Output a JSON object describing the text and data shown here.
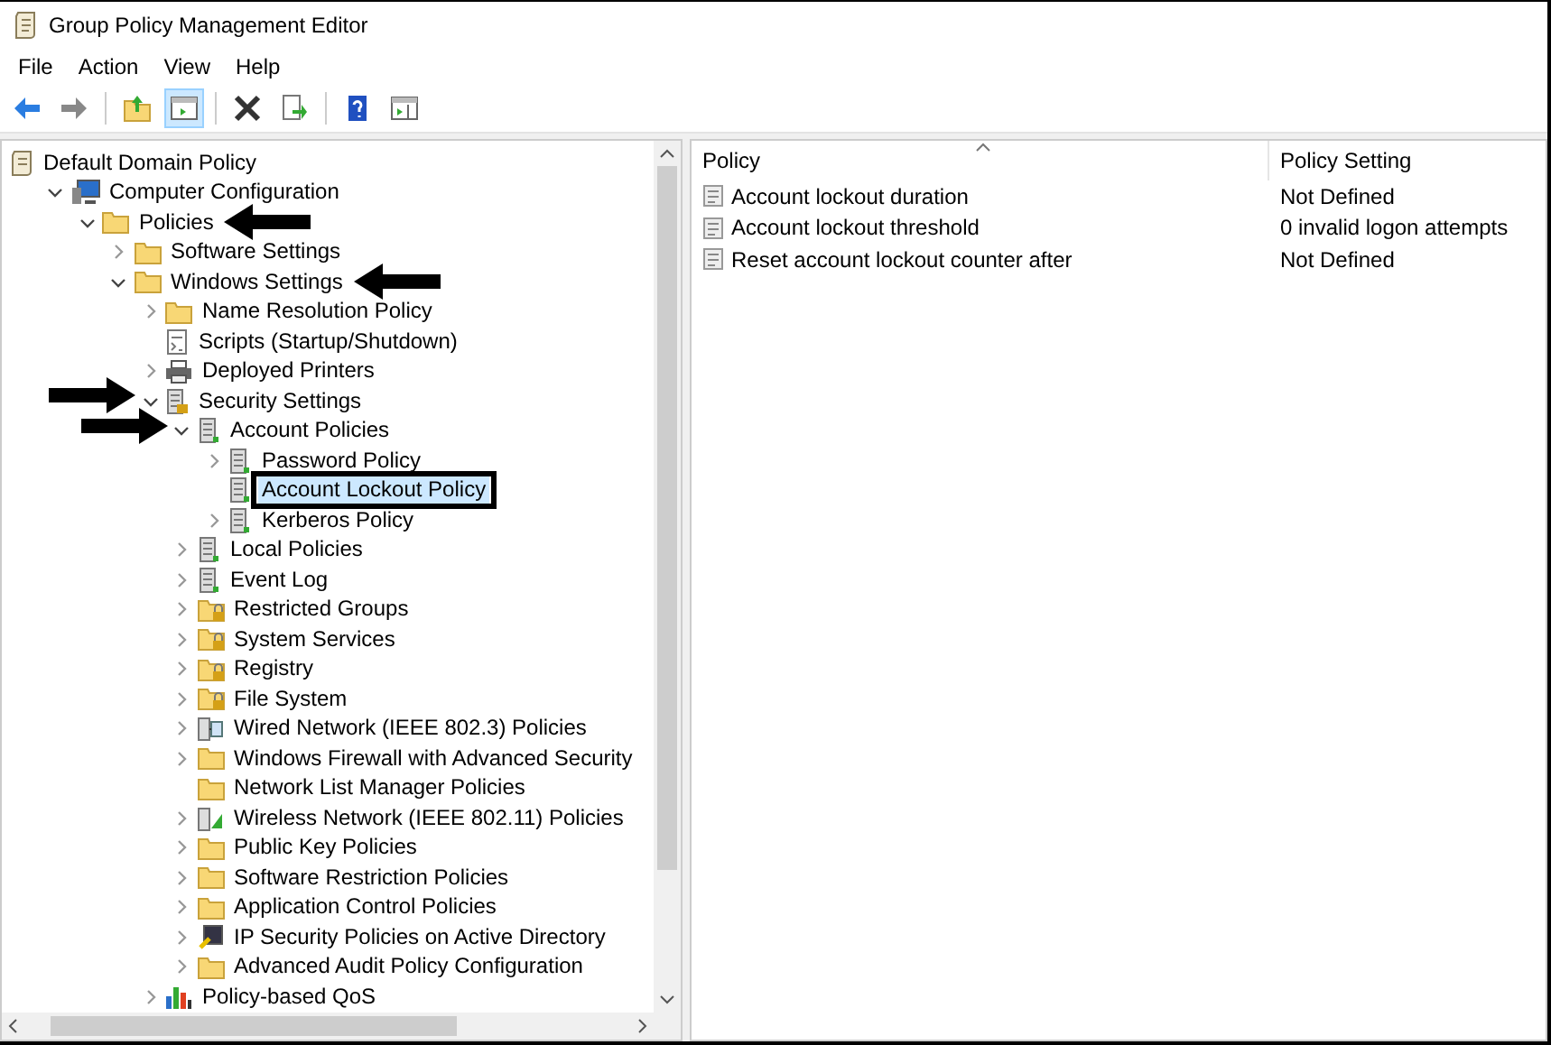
{
  "window": {
    "title": "Group Policy Management Editor"
  },
  "menu": [
    "File",
    "Action",
    "View",
    "Help"
  ],
  "tree": [
    {
      "label": "Default Domain Policy",
      "kind": "scroll",
      "selected": false,
      "outlined": false,
      "arrow_before": false,
      "arrow_after": false,
      "children": [
        {
          "label": "Computer Configuration",
          "kind": "computer",
          "leaf": false,
          "expanded": true,
          "selected": false,
          "outlined": false,
          "arrow_before": false,
          "arrow_after": false,
          "children": [
            {
              "label": "Policies",
              "kind": "folder",
              "leaf": false,
              "expanded": true,
              "selected": false,
              "outlined": false,
              "arrow_before": false,
              "arrow_after": true,
              "children": [
                {
                  "label": "Software Settings",
                  "kind": "folder",
                  "leaf": false,
                  "expanded": false,
                  "selected": false,
                  "outlined": false,
                  "arrow_before": false,
                  "arrow_after": false
                },
                {
                  "label": "Windows Settings",
                  "kind": "folder",
                  "leaf": false,
                  "expanded": true,
                  "selected": false,
                  "outlined": false,
                  "arrow_before": false,
                  "arrow_after": true,
                  "children": [
                    {
                      "label": "Name Resolution Policy",
                      "kind": "folder",
                      "leaf": false,
                      "expanded": false,
                      "selected": false,
                      "outlined": false,
                      "arrow_before": false,
                      "arrow_after": false
                    },
                    {
                      "label": "Scripts (Startup/Shutdown)",
                      "kind": "script",
                      "leaf": true,
                      "selected": false,
                      "outlined": false,
                      "arrow_before": false,
                      "arrow_after": false
                    },
                    {
                      "label": "Deployed Printers",
                      "kind": "printer",
                      "leaf": false,
                      "expanded": false,
                      "selected": false,
                      "outlined": false,
                      "arrow_before": false,
                      "arrow_after": false
                    },
                    {
                      "label": "Security Settings",
                      "kind": "security",
                      "leaf": false,
                      "expanded": true,
                      "selected": false,
                      "outlined": false,
                      "arrow_before": true,
                      "arrow_after": false,
                      "children": [
                        {
                          "label": "Account Policies",
                          "kind": "policy",
                          "leaf": false,
                          "expanded": true,
                          "selected": false,
                          "outlined": false,
                          "arrow_before": true,
                          "arrow_after": false,
                          "children": [
                            {
                              "label": "Password Policy",
                              "kind": "policy",
                              "leaf": false,
                              "expanded": false,
                              "selected": false,
                              "outlined": false,
                              "arrow_before": false,
                              "arrow_after": false
                            },
                            {
                              "label": "Account Lockout Policy",
                              "kind": "policy",
                              "leaf": true,
                              "selected": true,
                              "outlined": true,
                              "arrow_before": false,
                              "arrow_after": false
                            },
                            {
                              "label": "Kerberos Policy",
                              "kind": "policy",
                              "leaf": false,
                              "expanded": false,
                              "selected": false,
                              "outlined": false,
                              "arrow_before": false,
                              "arrow_after": false
                            }
                          ]
                        },
                        {
                          "label": "Local Policies",
                          "kind": "policy",
                          "leaf": false,
                          "expanded": false,
                          "selected": false,
                          "outlined": false,
                          "arrow_before": false,
                          "arrow_after": false
                        },
                        {
                          "label": "Event Log",
                          "kind": "policy",
                          "leaf": false,
                          "expanded": false,
                          "selected": false,
                          "outlined": false,
                          "arrow_before": false,
                          "arrow_after": false
                        },
                        {
                          "label": "Restricted Groups",
                          "kind": "lockfolder",
                          "leaf": false,
                          "expanded": false,
                          "selected": false,
                          "outlined": false,
                          "arrow_before": false,
                          "arrow_after": false
                        },
                        {
                          "label": "System Services",
                          "kind": "lockfolder",
                          "leaf": false,
                          "expanded": false,
                          "selected": false,
                          "outlined": false,
                          "arrow_before": false,
                          "arrow_after": false
                        },
                        {
                          "label": "Registry",
                          "kind": "lockfolder",
                          "leaf": false,
                          "expanded": false,
                          "selected": false,
                          "outlined": false,
                          "arrow_before": false,
                          "arrow_after": false
                        },
                        {
                          "label": "File System",
                          "kind": "lockfolder",
                          "leaf": false,
                          "expanded": false,
                          "selected": false,
                          "outlined": false,
                          "arrow_before": false,
                          "arrow_after": false
                        },
                        {
                          "label": "Wired Network (IEEE 802.3) Policies",
                          "kind": "network",
                          "leaf": false,
                          "expanded": false,
                          "selected": false,
                          "outlined": false,
                          "arrow_before": false,
                          "arrow_after": false
                        },
                        {
                          "label": "Windows Firewall with Advanced Security",
                          "kind": "folder",
                          "leaf": false,
                          "expanded": false,
                          "selected": false,
                          "outlined": false,
                          "arrow_before": false,
                          "arrow_after": false
                        },
                        {
                          "label": "Network List Manager Policies",
                          "kind": "folder",
                          "leaf": true,
                          "selected": false,
                          "outlined": false,
                          "arrow_before": false,
                          "arrow_after": false
                        },
                        {
                          "label": "Wireless Network (IEEE 802.11) Policies",
                          "kind": "wireless",
                          "leaf": false,
                          "expanded": false,
                          "selected": false,
                          "outlined": false,
                          "arrow_before": false,
                          "arrow_after": false
                        },
                        {
                          "label": "Public Key Policies",
                          "kind": "folder",
                          "leaf": false,
                          "expanded": false,
                          "selected": false,
                          "outlined": false,
                          "arrow_before": false,
                          "arrow_after": false
                        },
                        {
                          "label": "Software Restriction Policies",
                          "kind": "folder",
                          "leaf": false,
                          "expanded": false,
                          "selected": false,
                          "outlined": false,
                          "arrow_before": false,
                          "arrow_after": false
                        },
                        {
                          "label": "Application Control Policies",
                          "kind": "folder",
                          "leaf": false,
                          "expanded": false,
                          "selected": false,
                          "outlined": false,
                          "arrow_before": false,
                          "arrow_after": false
                        },
                        {
                          "label": "IP Security Policies on Active Directory",
                          "kind": "ipsec",
                          "leaf": false,
                          "expanded": false,
                          "selected": false,
                          "outlined": false,
                          "arrow_before": false,
                          "arrow_after": false
                        },
                        {
                          "label": "Advanced Audit Policy Configuration",
                          "kind": "folder",
                          "leaf": false,
                          "expanded": false,
                          "selected": false,
                          "outlined": false,
                          "arrow_before": false,
                          "arrow_after": false
                        }
                      ]
                    },
                    {
                      "label": "Policy-based QoS",
                      "kind": "qos",
                      "leaf": false,
                      "expanded": false,
                      "selected": false,
                      "outlined": false,
                      "arrow_before": false,
                      "arrow_after": false
                    }
                  ]
                }
              ]
            }
          ]
        }
      ]
    }
  ],
  "table": {
    "columns": [
      "Policy",
      "Policy Setting"
    ],
    "rows": [
      {
        "policy": "Account lockout duration",
        "setting": "Not Defined"
      },
      {
        "policy": "Account lockout threshold",
        "setting": "0 invalid logon attempts"
      },
      {
        "policy": "Reset account lockout counter after",
        "setting": "Not Defined"
      }
    ]
  }
}
